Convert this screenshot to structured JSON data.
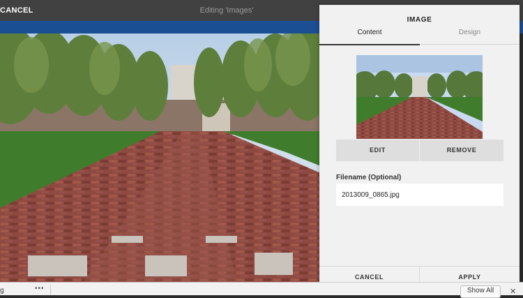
{
  "header": {
    "cancel_label": "CANCEL",
    "editing_title": "Editing 'Images'"
  },
  "panel": {
    "title": "IMAGE",
    "tabs": [
      {
        "label": "Content",
        "active": true
      },
      {
        "label": "Design",
        "active": false
      }
    ],
    "edit_label": "EDIT",
    "remove_label": "REMOVE",
    "filename_label": "Filename (Optional)",
    "filename_value": "2013009_0865.jpg",
    "cancel_label": "CANCEL",
    "apply_label": "APPLY"
  },
  "downloads": {
    "item_name": "g",
    "more_glyph": "•••",
    "show_all_label": "Show All",
    "close_glyph": "✕"
  },
  "colors": {
    "topbar": "#414141",
    "accent_blue": "#1b4f93",
    "panel_bg": "#f1f1f1",
    "button_bg": "#dedede"
  },
  "icons": {
    "more": "more-horizontal-icon",
    "close": "close-icon"
  }
}
